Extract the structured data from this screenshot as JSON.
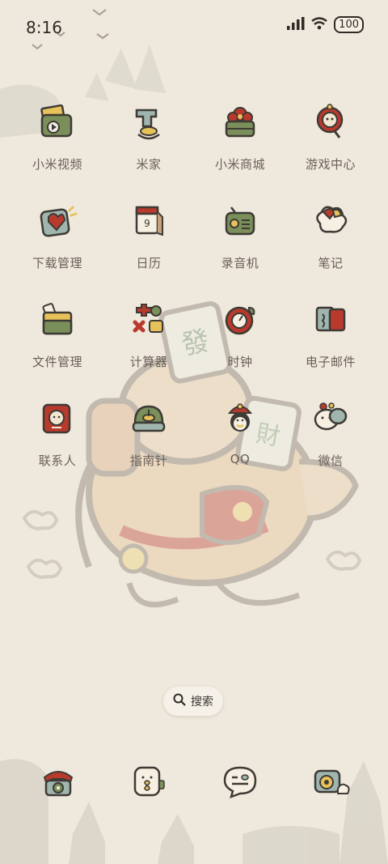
{
  "status_bar": {
    "time": "8:16",
    "battery": "100"
  },
  "apps": [
    {
      "label": "小米视频",
      "icon": "video-icon"
    },
    {
      "label": "米家",
      "icon": "home-icon"
    },
    {
      "label": "小米商城",
      "icon": "shop-icon"
    },
    {
      "label": "游戏中心",
      "icon": "game-icon"
    },
    {
      "label": "下载管理",
      "icon": "download-icon"
    },
    {
      "label": "日历",
      "icon": "calendar-icon",
      "day": "9"
    },
    {
      "label": "录音机",
      "icon": "recorder-icon"
    },
    {
      "label": "笔记",
      "icon": "notes-icon"
    },
    {
      "label": "文件管理",
      "icon": "files-icon"
    },
    {
      "label": "计算器",
      "icon": "calculator-icon"
    },
    {
      "label": "时钟",
      "icon": "clock-icon"
    },
    {
      "label": "电子邮件",
      "icon": "mail-icon"
    },
    {
      "label": "联系人",
      "icon": "contacts-icon"
    },
    {
      "label": "指南针",
      "icon": "compass-icon"
    },
    {
      "label": "QQ",
      "icon": "qq-icon"
    },
    {
      "label": "微信",
      "icon": "wechat-icon"
    }
  ],
  "search": {
    "label": "搜索"
  },
  "dock": [
    {
      "icon": "phone-icon"
    },
    {
      "icon": "messages-icon"
    },
    {
      "icon": "chat-icon"
    },
    {
      "icon": "camera-icon"
    }
  ],
  "colors": {
    "background": "#efe8dc",
    "red": "#b83a2d",
    "green": "#7a8f5a",
    "yellow": "#e7c15a",
    "outline": "#3e3a35"
  }
}
